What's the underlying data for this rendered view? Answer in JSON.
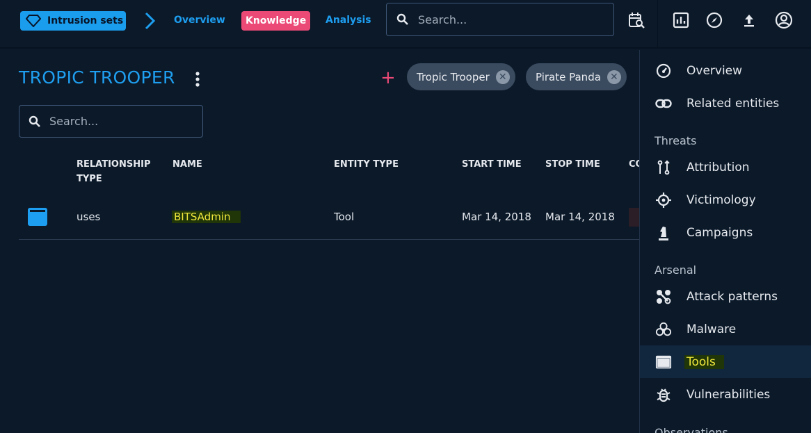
{
  "topbar": {
    "entity_chip": "Intrusion sets",
    "tabs": [
      "Overview",
      "Knowledge",
      "Analysis"
    ],
    "search_placeholder": "Search..."
  },
  "page": {
    "title": "TROPIC TROOPER",
    "aliases": [
      "Tropic Trooper",
      "Pirate Panda"
    ]
  },
  "search": {
    "placeholder": "Search..."
  },
  "table": {
    "headers": [
      "RELATIONSHIP TYPE",
      "NAME",
      "ENTITY TYPE",
      "START TIME",
      "STOP TIME",
      "CO"
    ],
    "rows": [
      {
        "relationship_type": "uses",
        "name": "BITSAdmin",
        "entity_type": "Tool",
        "start_time": "Mar 14, 2018",
        "stop_time": "Mar 14, 2018"
      }
    ]
  },
  "sidemenu": {
    "items_top": [
      {
        "label": "Overview",
        "icon": "gauge-icon"
      },
      {
        "label": "Related entities",
        "icon": "link-icon"
      }
    ],
    "sections": [
      {
        "title": "Threats",
        "items": [
          {
            "label": "Attribution",
            "icon": "attribution-icon"
          },
          {
            "label": "Victimology",
            "icon": "crosshair-icon"
          },
          {
            "label": "Campaigns",
            "icon": "chess-knight-icon"
          }
        ]
      },
      {
        "title": "Arsenal",
        "items": [
          {
            "label": "Attack patterns",
            "icon": "attack-pattern-icon"
          },
          {
            "label": "Malware",
            "icon": "biohazard-icon"
          },
          {
            "label": "Tools",
            "icon": "window-icon",
            "active": true
          },
          {
            "label": "Vulnerabilities",
            "icon": "bug-icon"
          }
        ]
      },
      {
        "title": "Observations",
        "items": []
      }
    ]
  },
  "colors": {
    "accent": "#1e9ef0",
    "knowledge": "#eb4a77",
    "background": "#0b1929",
    "highlight": "#f0e83c"
  }
}
